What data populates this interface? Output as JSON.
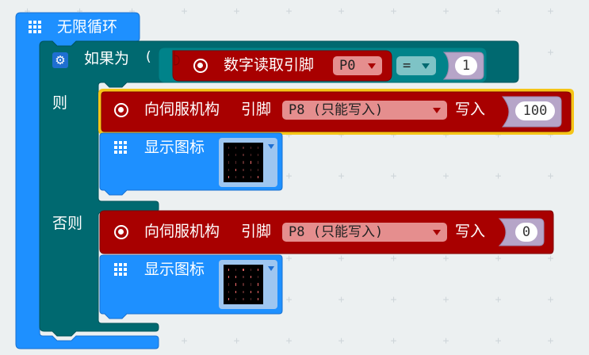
{
  "forever_block": {
    "label": "无限循环",
    "color": "#1e90ff"
  },
  "if_block": {
    "if_label": "如果为",
    "open_paren": "(",
    "then_label": "则",
    "else_label": "否则",
    "color": "#006970"
  },
  "condition": {
    "read_label": "数字读取引脚",
    "pin": "P0",
    "operator": "=",
    "compare_value": "1",
    "color": "#a80000"
  },
  "then_branch": {
    "servo": {
      "label": "向伺服机构",
      "pin_label": "引脚",
      "pin": "P8 (只能写入)",
      "write_label": "写入",
      "value": "100"
    },
    "show_icon": {
      "label": "显示图标",
      "leds": [
        [
          0,
          0,
          0,
          0,
          0
        ],
        [
          0,
          0,
          0,
          0,
          0
        ],
        [
          0,
          0,
          0,
          1,
          0
        ],
        [
          0,
          1,
          0,
          0,
          0
        ],
        [
          1,
          0,
          0,
          0,
          1
        ]
      ]
    }
  },
  "else_branch": {
    "servo": {
      "label": "向伺服机构",
      "pin_label": "引脚",
      "pin": "P8 (只能写入)",
      "write_label": "写入",
      "value": "0"
    },
    "show_icon": {
      "label": "显示图标",
      "leds": [
        [
          1,
          0,
          1,
          0,
          1
        ],
        [
          1,
          1,
          0,
          1,
          0
        ],
        [
          0,
          1,
          0,
          0,
          1
        ],
        [
          0,
          1,
          0,
          1,
          1
        ],
        [
          1,
          0,
          0,
          0,
          1
        ]
      ]
    }
  },
  "colors": {
    "workspace_bg": "#ecf0f1",
    "basic_blue": "#1e90ff",
    "logic_teal": "#006970",
    "pins_red": "#a80000",
    "selected_outline": "#f5c518",
    "value_slot": "#b6a5c8",
    "led_field": "#9ec6f0"
  }
}
